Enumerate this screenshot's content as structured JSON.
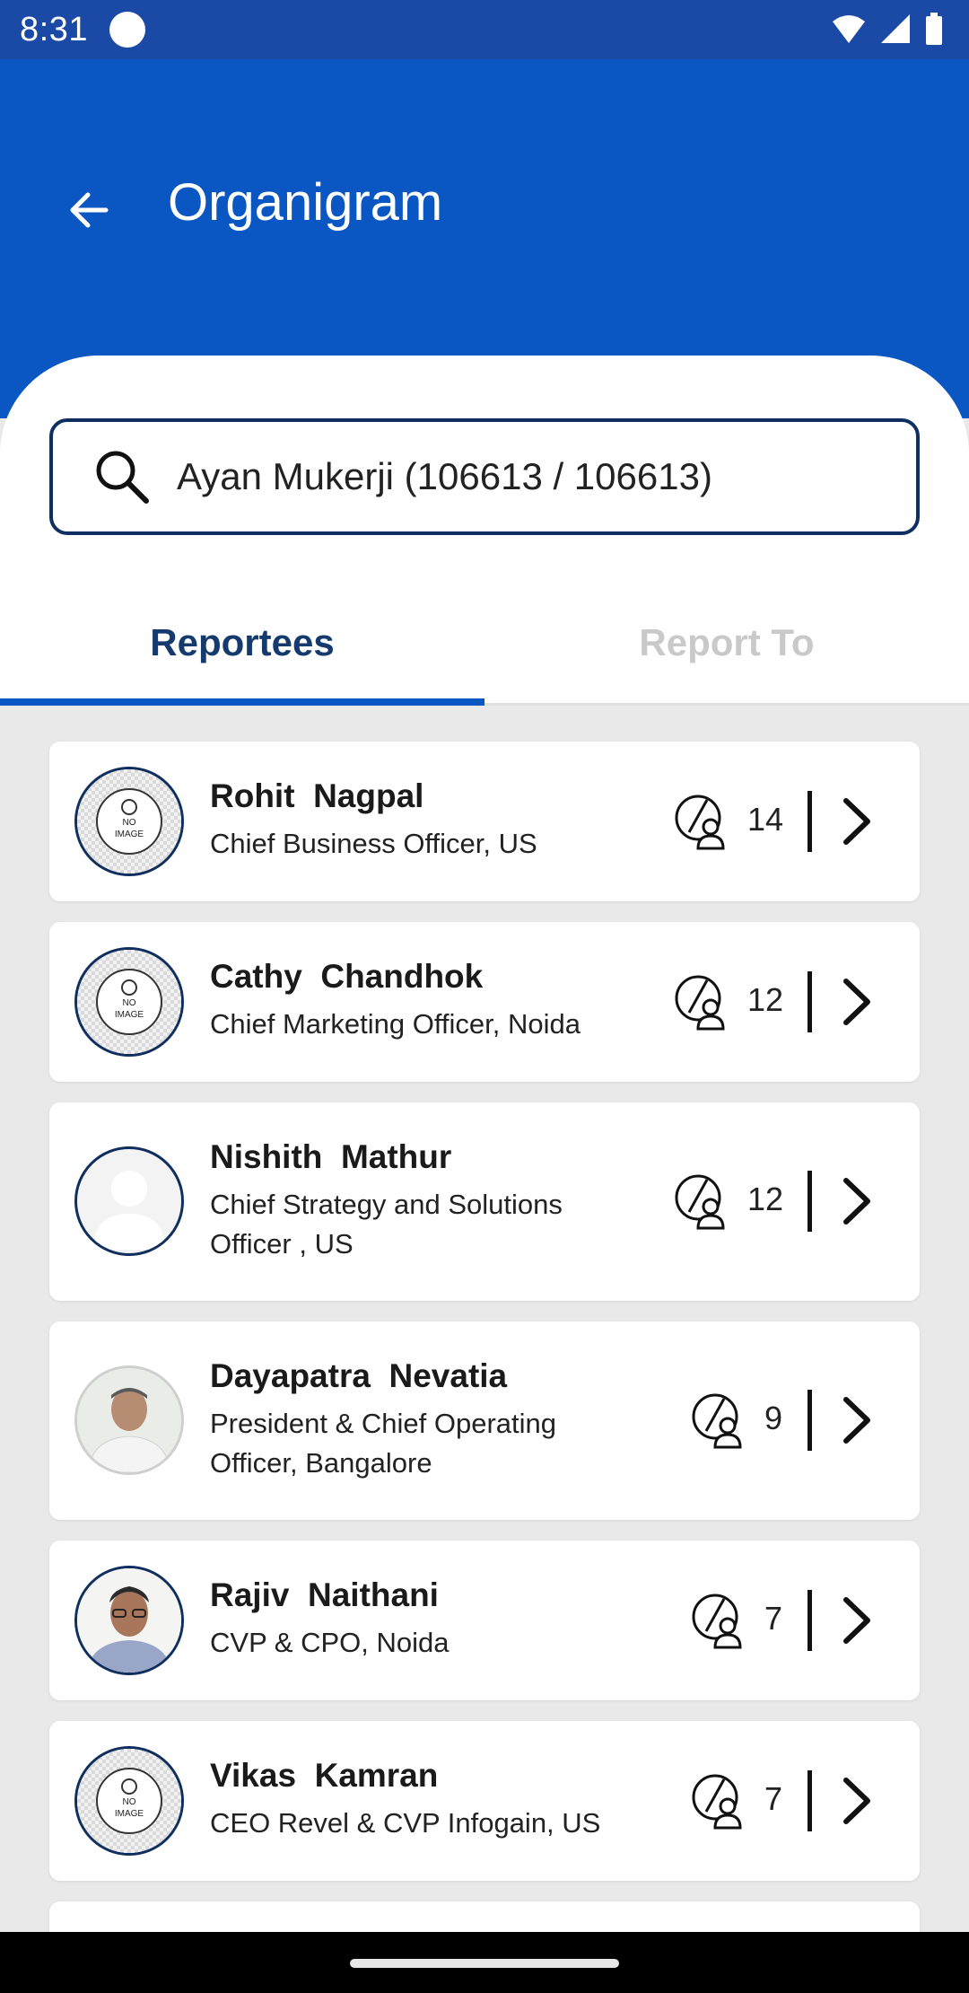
{
  "status_bar": {
    "time": "8:31"
  },
  "header": {
    "title": "Organigram"
  },
  "search": {
    "value": "Ayan Mukerji (106613 / 106613)"
  },
  "tabs": [
    {
      "label": "Reportees",
      "active": true
    },
    {
      "label": "Report To",
      "active": false
    }
  ],
  "no_image_label": "NO IMAGE",
  "reportees": [
    {
      "name": "Rohit  Nagpal",
      "role": "Chief Business Officer, US",
      "count": "14",
      "avatar": "no-image"
    },
    {
      "name": "Cathy  Chandhok",
      "role": "Chief Marketing Officer, Noida",
      "count": "12",
      "avatar": "no-image"
    },
    {
      "name": "Nishith  Mathur",
      "role": "Chief Strategy and Solutions Officer , US",
      "count": "12",
      "avatar": "placeholder"
    },
    {
      "name": "Dayapatra  Nevatia",
      "role": "President & Chief Operating Officer, Bangalore",
      "count": "9",
      "avatar": "photo"
    },
    {
      "name": "Rajiv  Naithani",
      "role": "CVP & CPO, Noida",
      "count": "7",
      "avatar": "photo"
    },
    {
      "name": "Vikas  Kamran",
      "role": "CEO Revel & CVP Infogain, US",
      "count": "7",
      "avatar": "no-image"
    }
  ],
  "colors": {
    "primary": "#0a57c4",
    "status_bar": "#1a4aa6",
    "navy": "#153a6d"
  }
}
